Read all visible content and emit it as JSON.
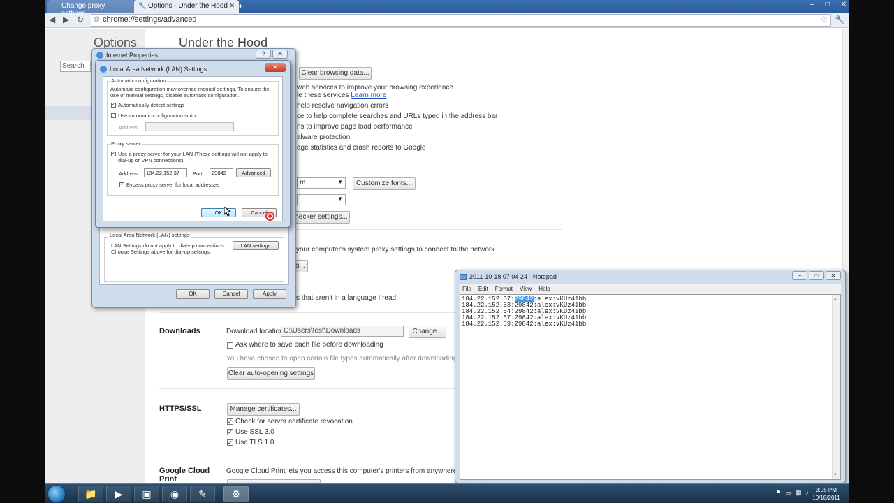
{
  "chrome": {
    "tabs": [
      {
        "label": "Change proxy settings"
      },
      {
        "label": "Options - Under the Hood"
      }
    ],
    "new_tab_label": "+",
    "address": "chrome://settings/advanced",
    "icons": {
      "back": "back-arrow-icon",
      "forward": "forward-arrow-icon",
      "reload": "reload-icon",
      "star": "star-icon",
      "wrench": "wrench-icon"
    }
  },
  "settings": {
    "nav_title": "Options",
    "search_placeholder": "Search o",
    "page_title": "Under the Hood",
    "privacy": {
      "clear_browsing_button": "Clear browsing data...",
      "lines": [
        "web services to improve your browsing experience.",
        "le these services",
        "help resolve navigation errors",
        "ce to help complete searches and URLs typed in the address bar",
        "ns to improve page load performance",
        "alware protection",
        "age statistics and crash reports to Google"
      ],
      "learn_more": "Learn more"
    },
    "web_content": {
      "font_select": "m",
      "customize_fonts": "Customize fonts...",
      "spellchecker": "hecker settings..."
    },
    "network": {
      "proxy_text": "your computer's system proxy settings to connect to the network.",
      "proxy_button": "s..."
    },
    "translate_text": "s that aren't in a language I read",
    "downloads": {
      "heading": "Downloads",
      "location_label": "Download location:",
      "location_value": "C:\\Users\\test\\Downloads",
      "change_button": "Change...",
      "ask_checkbox": "Ask where to save each file before downloading",
      "auto_open_text": "You have chosen to open certain file types automatically after downloading.",
      "clear_auto_button": "Clear auto-opening settings"
    },
    "https": {
      "heading": "HTTPS/SSL",
      "manage_button": "Manage certificates...",
      "checks": [
        {
          "label": "Check for server certificate revocation",
          "checked": true
        },
        {
          "label": "Use SSL 3.0",
          "checked": true
        },
        {
          "label": "Use TLS 1.0",
          "checked": true
        }
      ]
    },
    "cloud_print": {
      "heading": "Google Cloud Print",
      "text": "Google Cloud Print lets you access this computer's printers from anywhere. Sign in"
    }
  },
  "internet_properties": {
    "title": "Internet Properties",
    "help_btn": "?",
    "close_btn": "✕",
    "lan_group_label": "Local Area Network (LAN) settings",
    "lan_text": "LAN Settings do not apply to dial-up connections. Choose Settings above for dial-up settings.",
    "lan_button": "LAN settings",
    "ok": "OK",
    "cancel": "Cancel",
    "apply": "Apply"
  },
  "lan_dialog": {
    "title": "Local Area Network (LAN) Settings",
    "close_btn": "✕",
    "auto_config_label": "Automatic configuration",
    "auto_config_text": "Automatic configuration may override manual settings. To ensure the use of manual settings, disable automatic configuration.",
    "auto_detect": {
      "label": "Automatically detect settings",
      "checked": true
    },
    "use_script": {
      "label": "Use automatic configuration script",
      "checked": false
    },
    "script_address_label": "Address",
    "script_address_value": "",
    "proxy_label": "Proxy server",
    "use_proxy": {
      "label": "Use a proxy server for your LAN (These settings will not apply to dial-up or VPN connections).",
      "checked": true
    },
    "address_label": "Address:",
    "address_value": "184.22.152.37",
    "port_label": "Port:",
    "port_value": "29842",
    "advanced_button": "Advanced",
    "bypass": {
      "label": "Bypass proxy server for local addresses",
      "checked": true
    },
    "ok": "OK",
    "cancel": "Cancel"
  },
  "notepad": {
    "title": "2011-10-18 07 04 24 - Notepad",
    "menu": [
      "File",
      "Edit",
      "Format",
      "View",
      "Help"
    ],
    "lines": [
      {
        "prefix": "184.22.152.37:",
        "selected": "29842",
        "suffix": ":alex:vKUz41bb"
      },
      {
        "prefix": "184.22.152.53:29842:alex:vKUz41bb",
        "selected": "",
        "suffix": ""
      },
      {
        "prefix": "184.22.152.54:29842:alex:vKUz41bb",
        "selected": "",
        "suffix": ""
      },
      {
        "prefix": "184.22.152.57:29842:alex:vKUz41bb",
        "selected": "",
        "suffix": ""
      },
      {
        "prefix": "184.22.152.59:29842:alex:vKUz41bb",
        "selected": "",
        "suffix": ""
      }
    ]
  },
  "taskbar": {
    "clock_time": "3:05 PM",
    "clock_date": "10/18/2011"
  }
}
